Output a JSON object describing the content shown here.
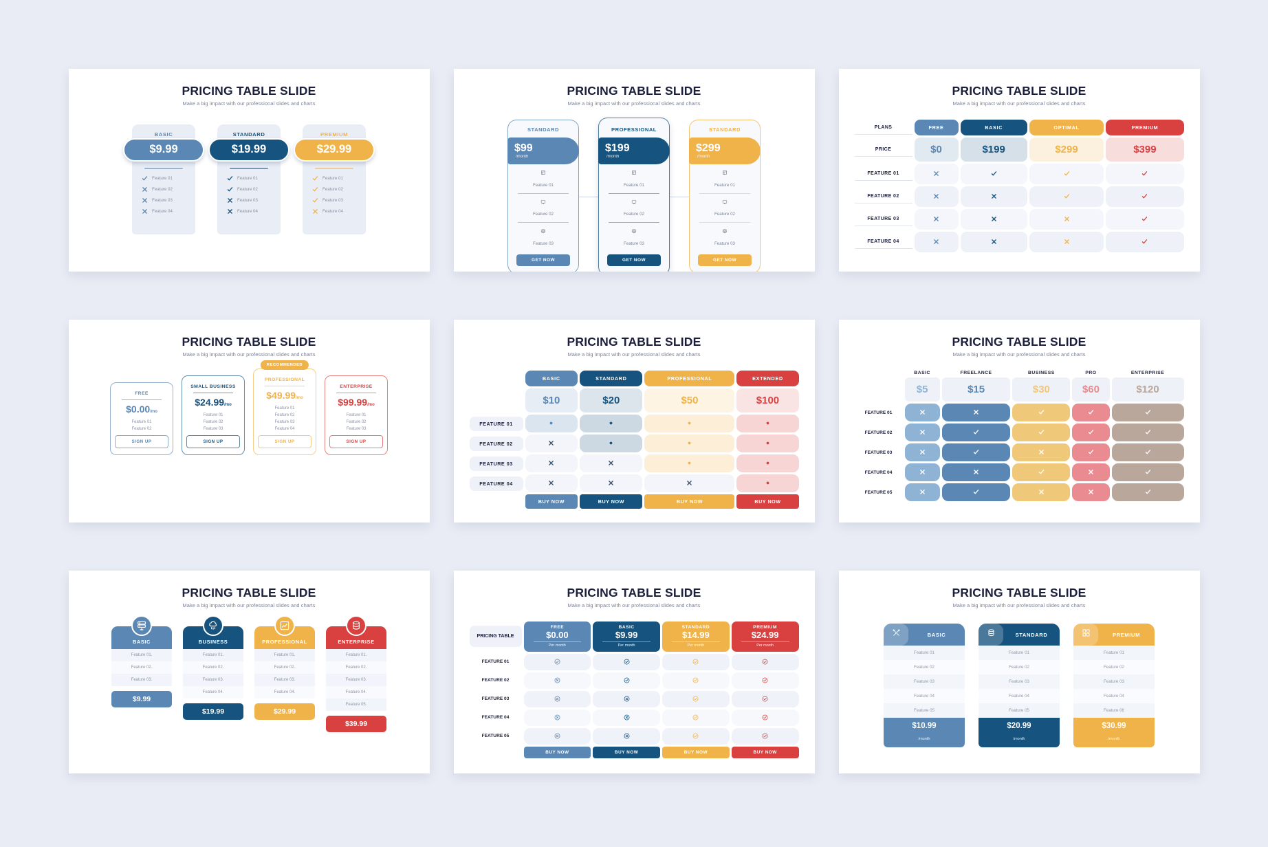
{
  "common": {
    "title": "PRICING TABLE SLIDE",
    "subtitle": "Make a big impact with our professional slides and charts"
  },
  "colors": {
    "steel_blue": "#5a87b4",
    "navy": "#16537e",
    "amber": "#f0b34a",
    "red": "#d94141",
    "light_blue_bg": "#e9edf6",
    "muted_text": "#8a90a2",
    "dark_text": "#1b1f3b"
  },
  "slides": [
    {
      "id": "slide-1",
      "plans": [
        {
          "name": "BASIC",
          "price": "$9.99",
          "accent": "#5a87b4",
          "features": [
            {
              "label": "Feature 01",
              "mark": "check"
            },
            {
              "label": "Feature 02",
              "mark": "cross"
            },
            {
              "label": "Feature 03",
              "mark": "cross"
            },
            {
              "label": "Feature 04",
              "mark": "cross"
            }
          ]
        },
        {
          "name": "STANDARD",
          "price": "$19.99",
          "accent": "#16537e",
          "features": [
            {
              "label": "Feature 01",
              "mark": "check"
            },
            {
              "label": "Feature 02",
              "mark": "check"
            },
            {
              "label": "Feature 03",
              "mark": "cross"
            },
            {
              "label": "Feature 04",
              "mark": "cross"
            }
          ]
        },
        {
          "name": "PREMIUM",
          "price": "$29.99",
          "accent": "#f0b34a",
          "features": [
            {
              "label": "Feature 01",
              "mark": "check"
            },
            {
              "label": "Feature 02",
              "mark": "check"
            },
            {
              "label": "Feature 03",
              "mark": "check"
            },
            {
              "label": "Feature 04",
              "mark": "cross"
            }
          ]
        }
      ]
    },
    {
      "id": "slide-2",
      "plans": [
        {
          "name": "STANDARD",
          "amount": "$99",
          "per": "/month",
          "accent": "#5a87b4",
          "button": "GET NOW",
          "features": [
            "Feature 01",
            "Feature 02",
            "Feature 03"
          ]
        },
        {
          "name": "PROFESSIONAL",
          "amount": "$199",
          "per": "/month",
          "accent": "#16537e",
          "button": "GET NOW",
          "features": [
            "Feature 01",
            "Feature 02",
            "Feature 03"
          ]
        },
        {
          "name": "STANDARD",
          "amount": "$299",
          "per": "/month",
          "accent": "#f0b34a",
          "button": "GET NOW",
          "features": [
            "Feature 01",
            "Feature 02",
            "Feature 03"
          ]
        }
      ]
    },
    {
      "id": "slide-3",
      "row_labels": [
        "PLANS",
        "PRICE",
        "FEATURE 01",
        "FEATURE 02",
        "FEATURE 03",
        "FEATURE 04"
      ],
      "columns": [
        {
          "name": "FREE",
          "price": "$0",
          "accent": "#5a87b4",
          "marks": [
            "cross",
            "cross",
            "cross",
            "cross"
          ]
        },
        {
          "name": "BASIC",
          "price": "$199",
          "accent": "#16537e",
          "marks": [
            "check",
            "cross",
            "cross",
            "cross"
          ]
        },
        {
          "name": "OPTIMAL",
          "price": "$299",
          "accent": "#f0b34a",
          "marks": [
            "check",
            "check",
            "cross",
            "cross"
          ]
        },
        {
          "name": "PREMIUM",
          "price": "$399",
          "accent": "#d94141",
          "marks": [
            "check",
            "check",
            "check",
            "check"
          ]
        }
      ]
    },
    {
      "id": "slide-4",
      "recommended_badge": "RECOMMENDED",
      "plans": [
        {
          "name": "FREE",
          "price": "$0.00",
          "per": "/mo",
          "accent": "#5a87b4",
          "button": "SIGN UP",
          "recommended": false,
          "features": [
            "Feature 01",
            "Feature 02"
          ]
        },
        {
          "name": "SMALL BUSINESS",
          "price": "$24.99",
          "per": "/mo",
          "accent": "#16537e",
          "button": "SIGN UP",
          "recommended": false,
          "features": [
            "Feature 01",
            "Feature 02",
            "Feature 03"
          ]
        },
        {
          "name": "PROFESSIONAL",
          "price": "$49.99",
          "per": "/mo",
          "accent": "#f0b34a",
          "button": "SIGN UP",
          "recommended": true,
          "features": [
            "Feature 01",
            "Feature 02",
            "Feature 03",
            "Feature 04"
          ]
        },
        {
          "name": "ENTERPRISE",
          "price": "$99.99",
          "per": "/mo",
          "accent": "#d94141",
          "button": "SIGN UP",
          "recommended": false,
          "features": [
            "Feature 01",
            "Feature 02",
            "Feature 03"
          ]
        }
      ]
    },
    {
      "id": "slide-5",
      "row_labels": [
        "FEATURE 01",
        "FEATURE 02",
        "FEATURE 03",
        "FEATURE 04"
      ],
      "columns": [
        {
          "name": "BASIC",
          "price": "$10",
          "accent": "#5a87b4",
          "button": "BUY NOW",
          "marks": [
            "dot",
            "cross",
            "cross",
            "cross"
          ]
        },
        {
          "name": "STANDARD",
          "price": "$20",
          "accent": "#16537e",
          "button": "BUY NOW",
          "marks": [
            "dot",
            "dot",
            "cross",
            "cross"
          ]
        },
        {
          "name": "PROFESSIONAL",
          "price": "$50",
          "accent": "#f0b34a",
          "button": "BUY NOW",
          "marks": [
            "dot",
            "dot",
            "dot",
            "cross"
          ]
        },
        {
          "name": "EXTENDED",
          "price": "$100",
          "accent": "#d94141",
          "button": "BUY NOW",
          "marks": [
            "dot",
            "dot",
            "dot",
            "dot"
          ]
        }
      ]
    },
    {
      "id": "slide-6",
      "row_labels": [
        "FEATURE 01",
        "FEATURE 02",
        "FEATURE 03",
        "FEATURE 04",
        "FEATURE 05"
      ],
      "columns": [
        {
          "name": "BASIC",
          "price": "$5",
          "accent": "#8fb3d4",
          "marks": [
            "cross",
            "cross",
            "cross",
            "cross",
            "cross"
          ]
        },
        {
          "name": "FREELANCE",
          "price": "$15",
          "accent": "#5a87b4",
          "marks": [
            "cross",
            "check",
            "check",
            "cross",
            "check"
          ]
        },
        {
          "name": "BUSINESS",
          "price": "$30",
          "accent": "#f0c879",
          "marks": [
            "check",
            "check",
            "cross",
            "check",
            "cross"
          ]
        },
        {
          "name": "PRO",
          "price": "$60",
          "accent": "#e98b90",
          "marks": [
            "check",
            "check",
            "check",
            "cross",
            "cross"
          ]
        },
        {
          "name": "ENTERPRISE",
          "price": "$120",
          "accent": "#b9a79c",
          "marks": [
            "check",
            "check",
            "check",
            "check",
            "check"
          ]
        }
      ]
    },
    {
      "id": "slide-7",
      "plans": [
        {
          "name": "BASIC",
          "price": "$9.99",
          "accent": "#5a87b4",
          "icon": "server-icon",
          "features": [
            "Feature 01.",
            "Feature 02.",
            "Feature 03."
          ]
        },
        {
          "name": "BUSINESS",
          "price": "$19.99",
          "accent": "#16537e",
          "icon": "cloud-rain-icon",
          "features": [
            "Feature 01.",
            "Feature 02.",
            "Feature 03.",
            "Feature 04."
          ]
        },
        {
          "name": "PROFESSIONAL",
          "price": "$29.99",
          "accent": "#f0b34a",
          "icon": "chart-icon",
          "features": [
            "Feature 01.",
            "Feature 02.",
            "Feature 03.",
            "Feature 04."
          ]
        },
        {
          "name": "ENTERPRISE",
          "price": "$39.99",
          "accent": "#d94141",
          "icon": "database-icon",
          "features": [
            "Feature 01.",
            "Feature 02.",
            "Feature 03.",
            "Feature 04.",
            "Feature 05."
          ]
        }
      ]
    },
    {
      "id": "slide-8",
      "corner_label": "PRICING TABLE",
      "row_labels": [
        "FEATURE 01",
        "FEATURE 02",
        "FEATURE 03",
        "FEATURE 04",
        "FEATURE 05"
      ],
      "columns": [
        {
          "name": "FREE",
          "price": "$0.00",
          "per": "Per month",
          "accent": "#5a87b4",
          "button": "BUY NOW",
          "marks": [
            "check",
            "cross",
            "cross",
            "cross",
            "cross"
          ]
        },
        {
          "name": "BASIC",
          "price": "$9.99",
          "per": "Per month",
          "accent": "#16537e",
          "button": "BUY NOW",
          "marks": [
            "check",
            "check",
            "cross",
            "cross",
            "cross"
          ]
        },
        {
          "name": "STANDARD",
          "price": "$14.99",
          "per": "Per month",
          "accent": "#f0b34a",
          "button": "BUY NOW",
          "marks": [
            "check",
            "check",
            "check",
            "check",
            "check"
          ]
        },
        {
          "name": "PREMIUM",
          "price": "$24.99",
          "per": "Per month",
          "accent": "#d94141",
          "button": "BUY NOW",
          "marks": [
            "check",
            "check",
            "check",
            "check",
            "check"
          ]
        }
      ]
    },
    {
      "id": "slide-9",
      "plans": [
        {
          "name": "BASIC",
          "price": "$10.99",
          "per": "/month",
          "accent": "#5a87b4",
          "icon": "tools-icon",
          "features": [
            "Feature 01",
            "Feature 02",
            "Feature 03",
            "Feature 04",
            "Feature 05"
          ]
        },
        {
          "name": "STANDARD",
          "price": "$20.99",
          "per": "/month",
          "accent": "#16537e",
          "icon": "database-icon",
          "features": [
            "Feature 01",
            "Feature 02",
            "Feature 03",
            "Feature 04",
            "Feature 05"
          ]
        },
        {
          "name": "PREMIUM",
          "price": "$30.99",
          "per": "/month",
          "accent": "#f0b34a",
          "icon": "grid-icon",
          "features": [
            "Feature 01",
            "Feature 02",
            "Feature 03",
            "Feature 04",
            "Feature 06"
          ]
        }
      ]
    }
  ]
}
